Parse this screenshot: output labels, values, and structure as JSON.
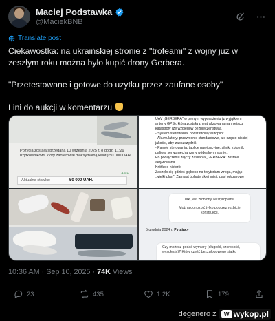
{
  "author": {
    "name": "Maciej Podstawka",
    "handle": "@MaciekBNB"
  },
  "translate_label": "Translate post",
  "tweet": {
    "paragraph_1": "Ciekawostka: na ukraińskiej stronie z \"trofeami\" z wojny już w zeszłym roku można było kupić drony Gerbera.",
    "paragraph_2": "\"Przetestowane i gotowe do uzytku przez zaufane osoby\"",
    "paragraph_3": "Lini do aukcji w komentarzu"
  },
  "media": {
    "listing_text": "Pozycja została sprzedana 10 września 2025 r. o godz. 11:29 użytkownikowi, który zaoferował maksymalną kwotę 50 000 UAH.",
    "amp_label": "AMP",
    "bid_label": "Aktualna stawka:",
    "bid_value": "50 000 UAH.",
    "description_lines": [
      "UAV „GERBERA\" w pełnym wyposażeniu (z wyjątkiem",
      "anteny GPS), która została zneutralizowana na miejscu",
      "katastrofy (ze względów bezpieczeństwa).",
      "- System sterowania: podstawowy autopilot.",
      "- Akumulatory: przewodnie standardowe, ale często niskiej",
      "jakości, aby zaoszczędzić.",
      "- Panele sterowania, tablice nawigacyjne, silnik, zbiornik",
      "paliwa, serwomechanizmy w idealnym stanie.",
      "Po podłączeniu złączy zasilania „GERBERA\" zostaje",
      "aktywowana.",
      "Krótko o historii:",
      "Zaczęło się gdzieś głęboko na terytorium wroga, mając",
      "„wielki plan\". Zamiast bohaterskiej misji, pasł odczarowe"
    ],
    "chat_bubble_line_1": "Tak, jest zrobiony ze styropianu.",
    "chat_bubble_line_2": "Można go rozbić tylko poprzez rozbicie konstrukcji.",
    "chat_date": "5 grudnia 2024 r.",
    "chat_author": "Pytający",
    "chat_question": "Czy możesz podać wymiary (długość, szerokość, wysokość)? Który część bezzałogowego statku"
  },
  "meta": {
    "time": "10:36 AM",
    "date": "Sep 10, 2025",
    "views": "74K",
    "views_label": "Views"
  },
  "stats": {
    "replies": "23",
    "reposts": "435",
    "likes": "1.2K",
    "bookmarks": "179"
  },
  "watermark": {
    "left": "degenero z",
    "site": "wykop.pl"
  },
  "colors": {
    "accent": "#1d9bf0",
    "muted": "#71767b",
    "background": "#000000"
  }
}
